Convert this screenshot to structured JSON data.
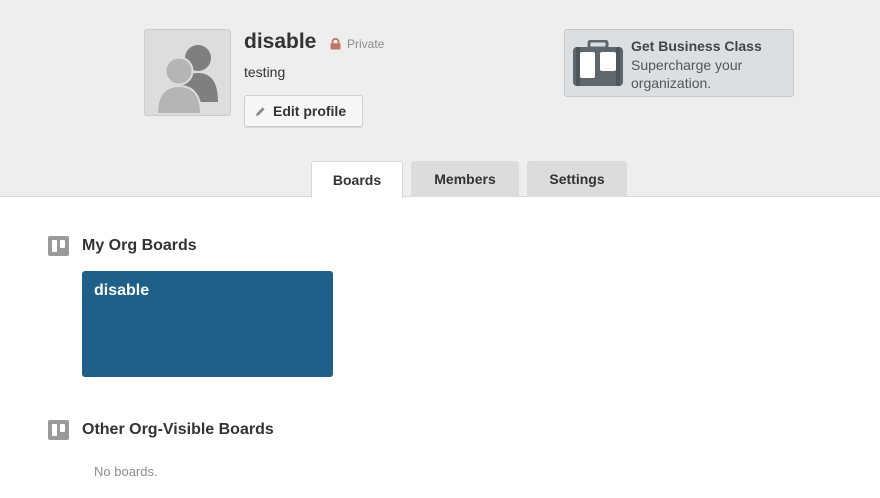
{
  "org": {
    "name": "disable",
    "visibility": "Private",
    "description": "testing",
    "edit_label": "Edit profile"
  },
  "business": {
    "title": "Get Business Class",
    "subtitle": "Supercharge your organization."
  },
  "tabs": [
    {
      "label": "Boards",
      "active": true
    },
    {
      "label": "Members",
      "active": false
    },
    {
      "label": "Settings",
      "active": false
    }
  ],
  "sections": {
    "my_boards": {
      "title": "My Org Boards",
      "boards": [
        {
          "name": "disable",
          "color": "#1e6089"
        }
      ]
    },
    "other_boards": {
      "title": "Other Org-Visible Boards",
      "empty_text": "No boards."
    }
  },
  "icons": {
    "avatar": "members-placeholder-icon",
    "visibility": "lock-icon",
    "edit": "pencil-icon",
    "business": "briefcase-icon",
    "section": "board-icon"
  },
  "colors": {
    "header_bg": "#eeeeee",
    "board_tile": "#1e6089",
    "lock": "#c0766b",
    "muted_text": "#8c8c8c"
  }
}
